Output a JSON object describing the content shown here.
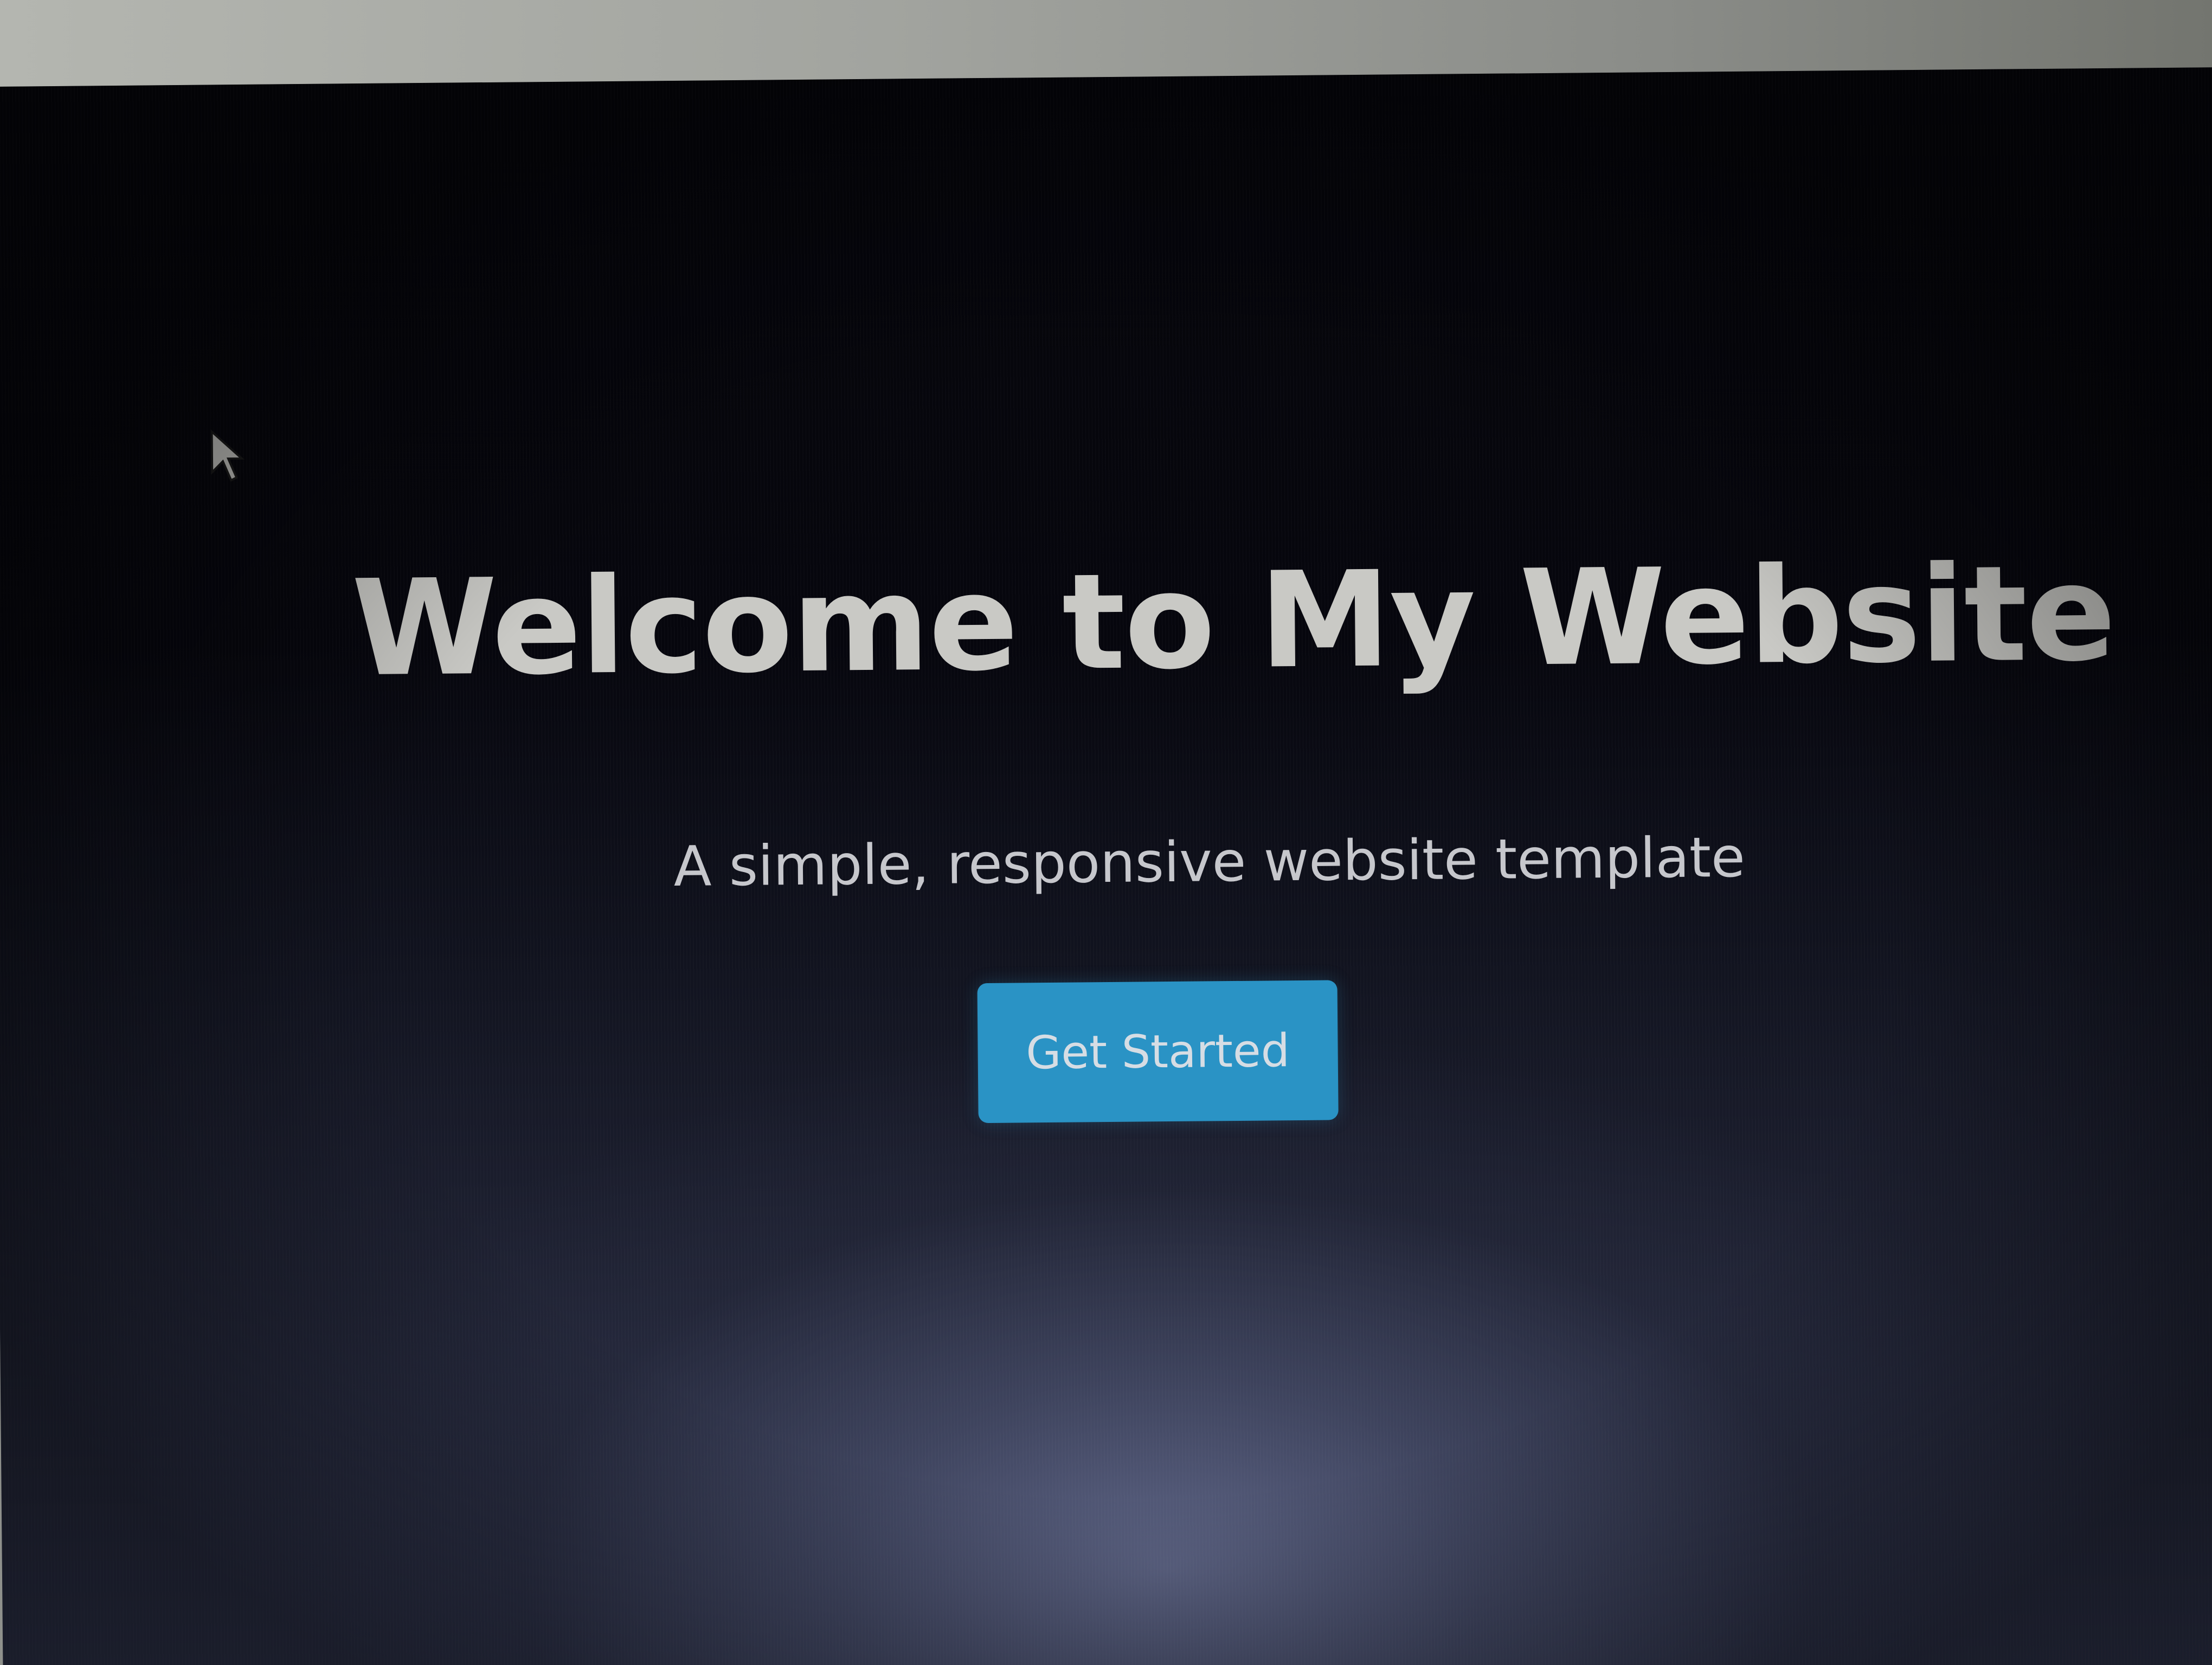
{
  "hero": {
    "title": "Welcome to My Website",
    "subtitle": "A simple, responsive website template",
    "cta_label": "Get Started"
  },
  "colors": {
    "background": "#06060d",
    "title_text": "#c9c9c5",
    "subtitle_text": "#c6c7cc",
    "button_fill": "#2a93c5",
    "button_text": "#d6dde4"
  },
  "icons": {
    "cursor": "mouse-pointer-arrow"
  }
}
